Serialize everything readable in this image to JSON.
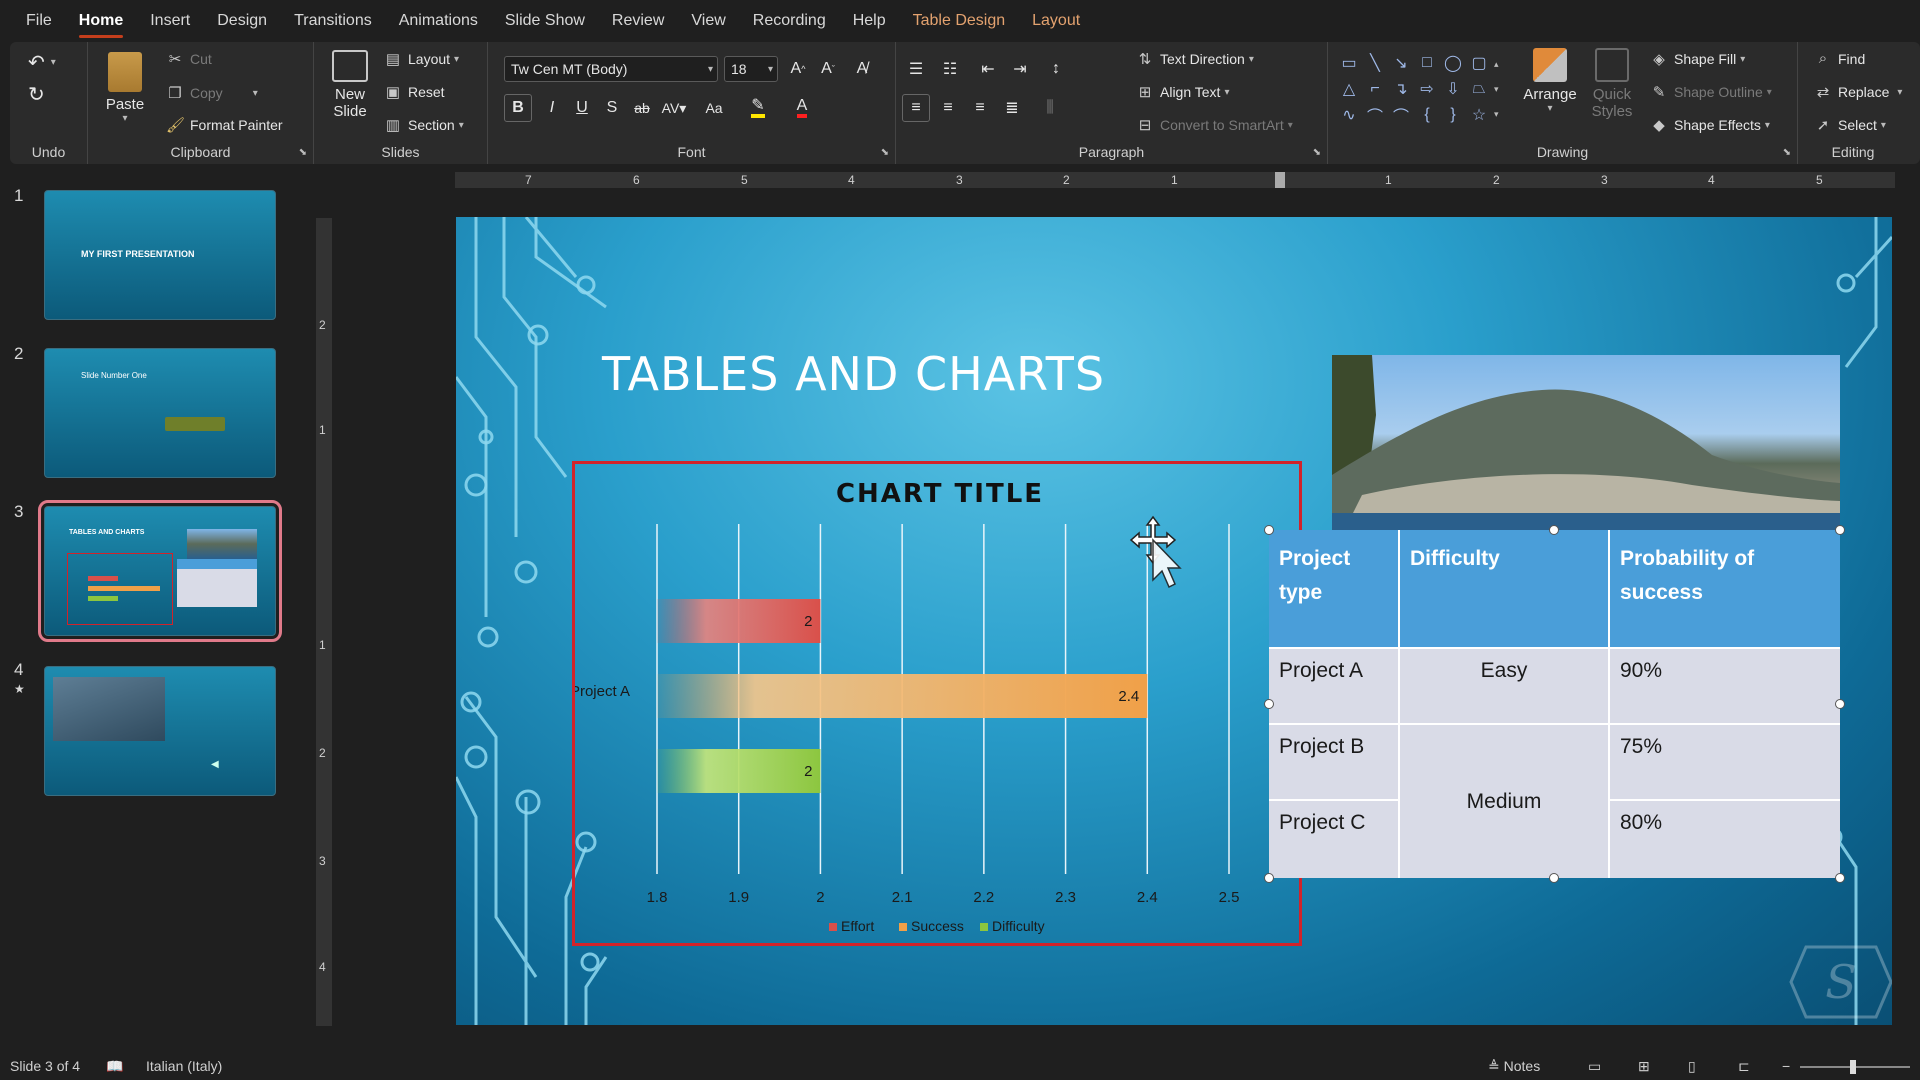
{
  "menu": {
    "tabs": [
      {
        "label": "File"
      },
      {
        "label": "Home"
      },
      {
        "label": "Insert"
      },
      {
        "label": "Design"
      },
      {
        "label": "Transitions"
      },
      {
        "label": "Animations"
      },
      {
        "label": "Slide Show"
      },
      {
        "label": "Review"
      },
      {
        "label": "View"
      },
      {
        "label": "Recording"
      },
      {
        "label": "Help"
      },
      {
        "label": "Table Design"
      },
      {
        "label": "Layout"
      }
    ],
    "active": "Home"
  },
  "ribbon": {
    "undo_group": "Undo",
    "clipboard": {
      "label": "Clipboard",
      "paste": "Paste",
      "cut": "Cut",
      "copy": "Copy",
      "format_painter": "Format Painter"
    },
    "slides": {
      "label": "Slides",
      "new_slide_1": "New",
      "new_slide_2": "Slide",
      "layout": "Layout",
      "reset": "Reset",
      "section": "Section"
    },
    "font": {
      "label": "Font",
      "font_name": "Tw Cen MT (Body)",
      "font_size": "18",
      "bold": "B",
      "italic": "I",
      "underline": "U",
      "shadow": "S",
      "strike": "ab",
      "case": "Aa"
    },
    "paragraph": {
      "label": "Paragraph",
      "text_direction": "Text Direction",
      "align_text": "Align Text",
      "smartart": "Convert to SmartArt"
    },
    "drawing": {
      "label": "Drawing",
      "arrange": "Arrange",
      "quick_styles_1": "Quick",
      "quick_styles_2": "Styles",
      "shape_fill": "Shape Fill",
      "shape_outline": "Shape Outline",
      "shape_effects": "Shape Effects"
    },
    "editing": {
      "label": "Editing",
      "find": "Find",
      "replace": "Replace",
      "select": "Select"
    }
  },
  "ruler": {
    "h_numbers": [
      "7",
      "6",
      "5",
      "4",
      "3",
      "2",
      "1",
      "1",
      "2",
      "3",
      "4",
      "5"
    ],
    "v_numbers": [
      "2",
      "1",
      "1",
      "2",
      "3",
      "4"
    ]
  },
  "thumbnails": [
    {
      "number": "1",
      "title": "MY FIRST PRESENTATION"
    },
    {
      "number": "2",
      "title": "Slide Number One"
    },
    {
      "number": "3",
      "title": "TABLES AND CHARTS"
    },
    {
      "number": "4",
      "title": ""
    }
  ],
  "slide": {
    "title": "TABLES AND CHARTS",
    "table": {
      "headers": [
        "Project type",
        "Difficulty",
        "Probability of success"
      ],
      "rows": [
        {
          "name": "Project A",
          "difficulty": "Easy",
          "probability": "90%"
        },
        {
          "name": "Project B",
          "difficulty": "Medium",
          "probability": "75%"
        },
        {
          "name": "Project C",
          "difficulty": "",
          "probability": "80%"
        }
      ]
    }
  },
  "chart_data": {
    "type": "bar",
    "orientation": "horizontal",
    "title": "CHART TITLE",
    "categories": [
      "Project A"
    ],
    "series": [
      {
        "name": "Effort",
        "values": [
          2
        ],
        "color": "#d9504a"
      },
      {
        "name": "Success",
        "values": [
          2.4
        ],
        "color": "#f0a048"
      },
      {
        "name": "Difficulty",
        "values": [
          2
        ],
        "color": "#8cc63f"
      }
    ],
    "xlim": [
      1.8,
      2.5
    ],
    "x_ticks": [
      "1.8",
      "1.9",
      "2",
      "2.1",
      "2.2",
      "2.3",
      "2.4",
      "2.5"
    ],
    "data_labels": [
      "2",
      "2.4",
      "2"
    ],
    "legend_position": "bottom",
    "grid": true
  },
  "status": {
    "slide_info": "Slide 3 of 4",
    "language": "Italian (Italy)",
    "notes": "Notes"
  },
  "colors": {
    "accent": "#c43e1c",
    "chart_border": "#d2232a",
    "table_header": "#4a9ed9",
    "table_body": "#d9dbe7"
  }
}
